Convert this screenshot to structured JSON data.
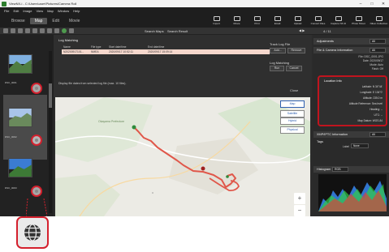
{
  "window": {
    "title": "ViewNX-i - C:\\Users\\user\\Pictures\\Camera Roll",
    "controls": [
      "–",
      "□",
      "✕"
    ]
  },
  "menu": [
    "File",
    "Edit",
    "Image",
    "View",
    "Map",
    "Window",
    "Help"
  ],
  "modes": [
    {
      "label": "Browse",
      "active": false
    },
    {
      "label": "Map",
      "active": true
    },
    {
      "label": "Edit",
      "active": false
    },
    {
      "label": "Movie",
      "active": false
    }
  ],
  "toolbar": [
    {
      "icon": "import-icon",
      "label": "Import"
    },
    {
      "icon": "movie-icon",
      "label": "Movie"
    },
    {
      "icon": "print-icon",
      "label": "Print"
    },
    {
      "icon": "email-icon",
      "label": "Email"
    },
    {
      "icon": "upload-icon",
      "label": "Upload"
    },
    {
      "icon": "convert-files-icon",
      "label": "Convert Files"
    },
    {
      "icon": "capture-nx-icon",
      "label": "Capture NX-D"
    },
    {
      "icon": "photo-shoot-icon",
      "label": "Photo Shoot"
    },
    {
      "icon": "nikon-collection-icon",
      "label": "Nikon Collection"
    }
  ],
  "toolbar2": {
    "search_label": "Search Maps",
    "search_result": "Search Result",
    "pager": "4 / 11"
  },
  "filmstrip": {
    "thumbs": [
      {
        "label": "DSC_0001"
      },
      {
        "label": "DSC_0002"
      },
      {
        "label": "DSC_0003"
      }
    ]
  },
  "log_matching": {
    "title": "Log Matching",
    "columns": [
      "Name",
      "File type",
      "Start date/time",
      "End date/time"
    ],
    "rows": [
      {
        "name": "N20200917101...",
        "type": "NMEA",
        "start": "2020/09/17 10:52:11",
        "end": "2020/09/17 15:09:14"
      }
    ],
    "track_log_label": "Track Log File",
    "add_label": "Add...",
    "remove_label": "Remove",
    "match_label": "Log Matching",
    "run_label": "Run",
    "cancel_label": "Cancel",
    "display_note": "Display file dates from selected log file (max. 10 files).",
    "close_label": "Close"
  },
  "map": {
    "types": [
      "Map",
      "Satellite",
      "Hybrid",
      "Physical"
    ],
    "active_type": "Map",
    "place_label": "Okayama Prefecture",
    "zoom_in": "+",
    "zoom_out": "−"
  },
  "right_panel": {
    "adjustments": {
      "label": "Adjustments",
      "value": "All"
    },
    "file_info": {
      "label": "File & Camera Information",
      "value": "All"
    },
    "file_lines": [
      "File: DSC_0001.JPG",
      "Date: 2020/09/17",
      "Mode: Auto",
      "Flash: Off"
    ],
    "location": {
      "title": "Location Info",
      "rows": [
        {
          "label": "Latitude:",
          "value": "N 34°44'"
        },
        {
          "label": "Longitude:",
          "value": "E 134°0'"
        },
        {
          "label": "Altitude:",
          "value": "235.0 m"
        },
        {
          "label": "Altitude Reference:",
          "value": "Sea level"
        },
        {
          "label": "Heading:",
          "value": "--"
        },
        {
          "label": "UTC:",
          "value": "--"
        },
        {
          "label": "Map Datum:",
          "value": "WGS-84"
        }
      ]
    },
    "xmp": {
      "label": "XMP/IPTC Information",
      "value": "All"
    },
    "tags": {
      "label": "Tags",
      "label_field": "Label",
      "value": "None"
    },
    "histogram": {
      "label": "Histogram",
      "value": "RGB"
    }
  }
}
